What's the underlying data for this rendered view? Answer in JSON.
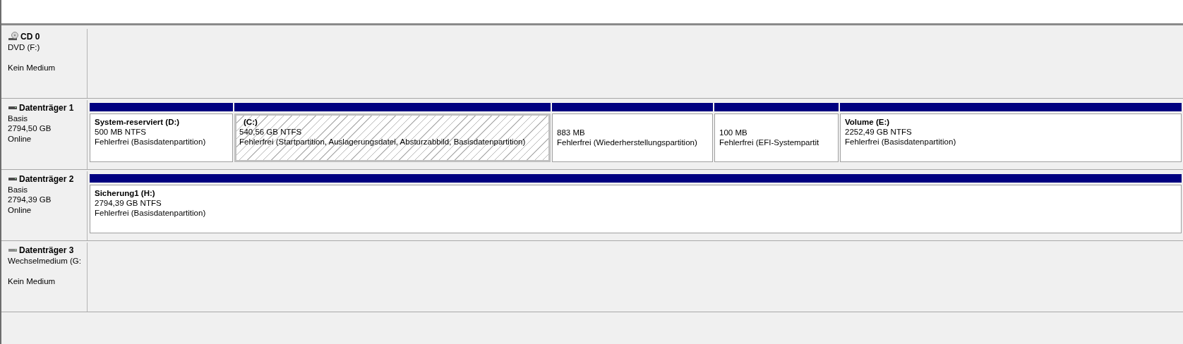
{
  "disks": [
    {
      "kind": "cd",
      "name": "CD 0",
      "type": "DVD (F:)",
      "status": "Kein Medium"
    },
    {
      "kind": "disk",
      "name": "Datenträger 1",
      "type": "Basis",
      "size": "2794,50 GB",
      "status": "Online",
      "partitions": [
        {
          "name": "System-reserviert  (D:)",
          "size": "500 MB NTFS",
          "status": "Fehlerfrei (Basisdatenpartition)",
          "selected": false
        },
        {
          "name": "(C:)",
          "size": "540,56 GB NTFS",
          "status": "Fehlerfrei (Startpartition, Auslagerungsdatei, Absturzabbild, Basisdatenpartition)",
          "selected": true
        },
        {
          "size": "883 MB",
          "status": "Fehlerfrei (Wiederherstellungspartition)",
          "selected": false
        },
        {
          "size": "100 MB",
          "status": "Fehlerfrei (EFI-Systempartit",
          "selected": false
        },
        {
          "name": "Volume  (E:)",
          "size": "2252,49 GB NTFS",
          "status": "Fehlerfrei (Basisdatenpartition)",
          "selected": false
        }
      ]
    },
    {
      "kind": "disk",
      "name": "Datenträger 2",
      "type": "Basis",
      "size": "2794,39 GB",
      "status": "Online",
      "partitions": [
        {
          "name": "Sicherung1  (H:)",
          "size": "2794,39 GB NTFS",
          "status": "Fehlerfrei (Basisdatenpartition)",
          "selected": false
        }
      ]
    },
    {
      "kind": "removable",
      "name": "Datenträger 3",
      "type": "Wechselmedium (G:",
      "status": "Kein Medium"
    }
  ]
}
